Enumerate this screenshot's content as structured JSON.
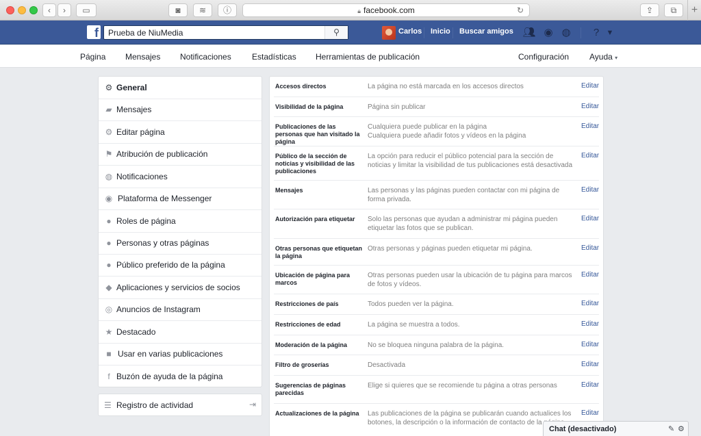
{
  "browser": {
    "url": "facebook.com"
  },
  "topbar": {
    "search_value": "Prueba de NiuMedia",
    "user_name": "Carlos",
    "home_label": "Inicio",
    "find_friends_label": "Buscar amigos"
  },
  "page_tabs": {
    "pagina": "Página",
    "mensajes": "Mensajes",
    "notificaciones": "Notificaciones",
    "estadisticas": "Estadísticas",
    "herramientas": "Herramientas de publicación",
    "configuracion": "Configuración",
    "ayuda": "Ayuda",
    "ayuda_caret": "▾"
  },
  "sidebar": {
    "items": [
      {
        "label": "General"
      },
      {
        "label": "Mensajes"
      },
      {
        "label": "Editar página"
      },
      {
        "label": "Atribución de publicación"
      },
      {
        "label": "Notificaciones"
      },
      {
        "label": "Plataforma de Messenger"
      },
      {
        "label": "Roles de página"
      },
      {
        "label": "Personas y otras páginas"
      },
      {
        "label": "Público preferido de la página"
      },
      {
        "label": "Aplicaciones y servicios de socios"
      },
      {
        "label": "Anuncios de Instagram"
      },
      {
        "label": "Destacado"
      },
      {
        "label": "Usar en varias publicaciones"
      },
      {
        "label": "Buzón de ayuda de la página"
      }
    ],
    "activity_label": "Registro de actividad"
  },
  "settings": {
    "edit_label": "Editar",
    "rows": [
      {
        "name": "Accesos directos",
        "value": "La página no está marcada en los accesos directos"
      },
      {
        "name": "Visibilidad de la página",
        "value": "Página sin publicar"
      },
      {
        "name": "Publicaciones de las personas que han visitado la página",
        "value": "Cualquiera puede publicar en la página\nCualquiera puede añadir fotos y vídeos en la página"
      },
      {
        "name": "Público de la sección de noticias y visibilidad de las publicaciones",
        "value": "La opción para reducir el público potencial para la sección de noticias y limitar la visibilidad de tus publicaciones está desactivada"
      },
      {
        "name": "Mensajes",
        "value": "Las personas y las páginas pueden contactar con mi página de forma privada."
      },
      {
        "name": "Autorización para etiquetar",
        "value": "Solo las personas que ayudan a administrar mi página pueden etiquetar las fotos que se publican."
      },
      {
        "name": "Otras personas que etiquetan la página",
        "value": "Otras personas y páginas pueden etiquetar mi página."
      },
      {
        "name": "Ubicación de página para marcos",
        "value": "Otras personas pueden usar la ubicación de tu página para marcos de fotos y vídeos."
      },
      {
        "name": "Restricciones de país",
        "value": "Todos pueden ver la página."
      },
      {
        "name": "Restricciones de edad",
        "value": "La página se muestra a todos."
      },
      {
        "name": "Moderación de la página",
        "value": "No se bloquea ninguna palabra de la página."
      },
      {
        "name": "Filtro de groserías",
        "value": "Desactivada"
      },
      {
        "name": "Sugerencias de páginas parecidas",
        "value": "Elige si quieres que se recomiende tu página a otras personas"
      },
      {
        "name": "Actualizaciones de la página",
        "value": "Las publicaciones de la página se publicarán cuando actualices los botones, la descripción o la información de contacto de la página"
      }
    ]
  },
  "chat": {
    "label": "Chat (desactivado)"
  }
}
